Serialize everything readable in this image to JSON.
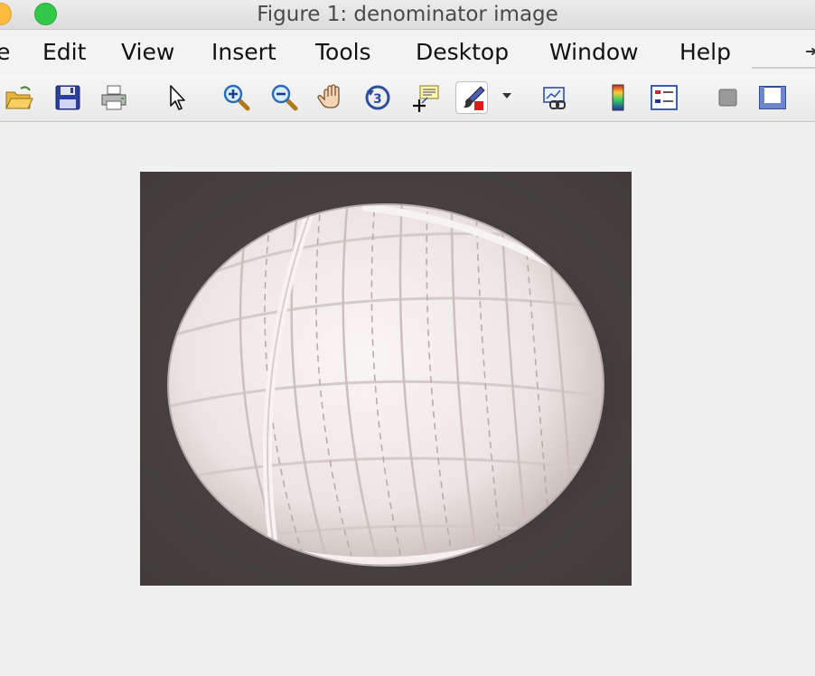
{
  "window": {
    "title": "Figure 1: denominator image"
  },
  "menubar": {
    "items": [
      {
        "label": "e",
        "name": "menu-file"
      },
      {
        "label": "Edit",
        "name": "menu-edit"
      },
      {
        "label": "View",
        "name": "menu-view"
      },
      {
        "label": "Insert",
        "name": "menu-insert"
      },
      {
        "label": "Tools",
        "name": "menu-tools"
      },
      {
        "label": "Desktop",
        "name": "menu-desktop"
      },
      {
        "label": "Window",
        "name": "menu-window"
      },
      {
        "label": "Help",
        "name": "menu-help"
      }
    ]
  },
  "toolbar": {
    "icons": [
      "open-file-icon",
      "save-icon",
      "print-icon",
      "edit-plot-icon",
      "zoom-in-icon",
      "zoom-out-icon",
      "pan-icon",
      "rotate-3d-icon",
      "data-cursor-icon",
      "brush-icon",
      "link-plot-icon",
      "colorbar-icon",
      "legend-icon",
      "hide-plot-tools-icon",
      "show-plot-tools-icon"
    ]
  },
  "figure": {
    "image_subject": "ball of twine",
    "background_color": "#494442"
  }
}
